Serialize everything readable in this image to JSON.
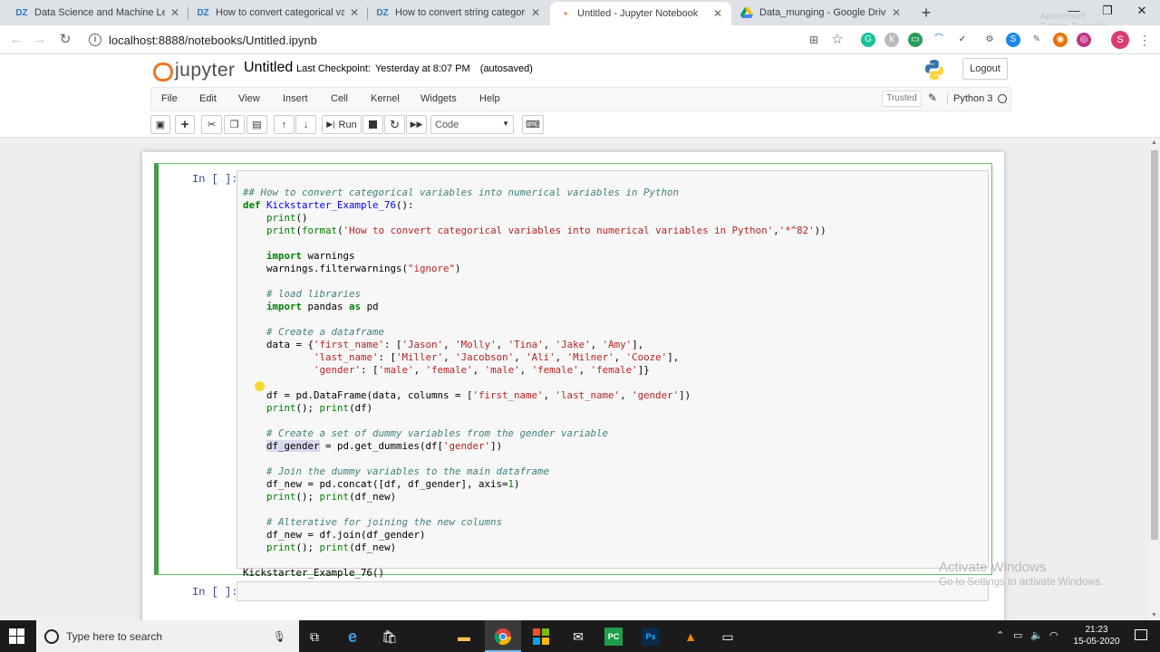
{
  "browser": {
    "tabs": [
      {
        "label": "Data Science and Machine Learni",
        "favicon": "DZ",
        "active": false
      },
      {
        "label": "How to convert categorical varia",
        "favicon": "DZ",
        "active": false
      },
      {
        "label": "How to convert string categorica",
        "favicon": "DZ",
        "active": false
      },
      {
        "label": "Untitled - Jupyter Notebook",
        "favicon": "jupyter-icon",
        "active": true
      },
      {
        "label": "Data_munging - Google Drive",
        "favicon": "drive-icon",
        "active": false
      }
    ],
    "url": "localhost:8888/notebooks/Untitled.ipynb",
    "profile_initial": "S",
    "watermark_line1": "Apowersoft",
    "watermark_line2": "Screen Recorder"
  },
  "jupyter": {
    "logo_text": "jupyter",
    "notebook_title": "Untitled",
    "checkpoint_label": "Last Checkpoint:",
    "checkpoint_time": "Yesterday at 8:07 PM",
    "autosave": "(autosaved)",
    "logout_label": "Logout",
    "menu": [
      "File",
      "Edit",
      "View",
      "Insert",
      "Cell",
      "Kernel",
      "Widgets",
      "Help"
    ],
    "trusted_label": "Trusted",
    "kernel_name": "Python 3",
    "run_label": "Run",
    "cell_type": "Code"
  },
  "cells": [
    {
      "prompt": "In [ ]:",
      "code_lines": [
        "## How to convert categorical variables into numerical variables in Python",
        "def Kickstarter_Example_76():",
        "    print()",
        "    print(format('How to convert categorical variables into numerical variables in Python','*^82'))",
        "",
        "    import warnings",
        "    warnings.filterwarnings(\"ignore\")",
        "",
        "    # load libraries",
        "    import pandas as pd",
        "",
        "    # Create a dataframe",
        "    data = {'first_name': ['Jason', 'Molly', 'Tina', 'Jake', 'Amy'],",
        "            'last_name': ['Miller', 'Jacobson', 'Ali', 'Milner', 'Cooze'],",
        "            'gender': ['male', 'female', 'male', 'female', 'female']}",
        "",
        "    df = pd.DataFrame(data, columns = ['first_name', 'last_name', 'gender'])",
        "    print(); print(df)",
        "",
        "    # Create a set of dummy variables from the gender variable",
        "    df_gender = pd.get_dummies(df['gender'])",
        "",
        "    # Join the dummy variables to the main dataframe",
        "    df_new = pd.concat([df, df_gender], axis=1)",
        "    print(); print(df_new)",
        "",
        "    # Alterative for joining the new columns",
        "    df_new = df.join(df_gender)",
        "    print(); print(df_new)",
        "",
        "Kickstarter_Example_76()"
      ]
    },
    {
      "prompt": "In [ ]:",
      "code_lines": []
    }
  ],
  "overlay": {
    "activate_title": "Activate Windows",
    "activate_sub": "Go to Settings to activate Windows."
  },
  "taskbar": {
    "search_placeholder": "Type here to search",
    "time": "21:23",
    "date": "15-05-2020"
  },
  "colors": {
    "jupyter_orange": "#f37626",
    "selected_cell_green": "#42a047",
    "prompt_blue": "#303f9f"
  }
}
